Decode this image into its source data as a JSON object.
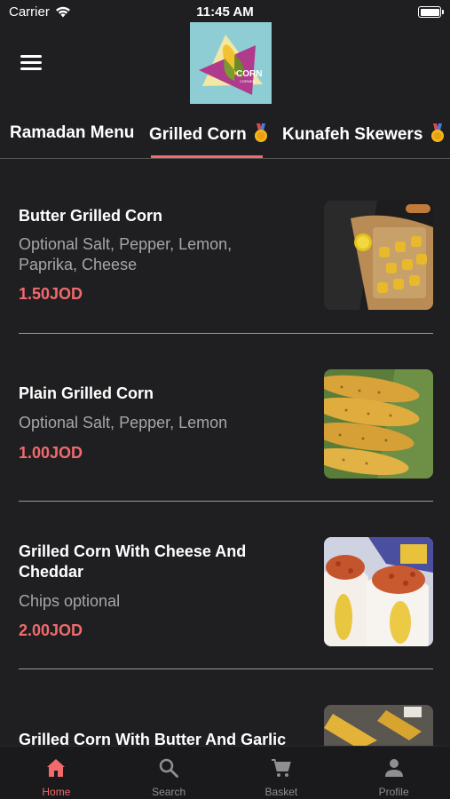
{
  "status_bar": {
    "carrier": "Carrier",
    "time": "11:45 AM"
  },
  "header": {
    "logo_text": "CORN",
    "logo_subtext": "CORNER"
  },
  "categories": [
    {
      "label": "Ramadan Menu"
    },
    {
      "label": "Grilled Corn",
      "selected": true
    },
    {
      "label": "Kunafeh Skewers"
    }
  ],
  "items": [
    {
      "name": "Butter Grilled Corn",
      "description": "Optional Salt, Pepper, Lemon, Paprika, Cheese",
      "price": "1.50JOD"
    },
    {
      "name": "Plain Grilled Corn",
      "description": "Optional Salt, Pepper, Lemon",
      "price": "1.00JOD"
    },
    {
      "name": "Grilled Corn With Cheese And Cheddar",
      "description": "Chips optional",
      "price": "2.00JOD"
    },
    {
      "name": "Grilled Corn With Butter And Garlic",
      "description": "",
      "price": ""
    }
  ],
  "tab_bar": [
    {
      "label": "Home",
      "icon": "home-icon",
      "active": true
    },
    {
      "label": "Search",
      "icon": "search-icon"
    },
    {
      "label": "Basket",
      "icon": "cart-icon"
    },
    {
      "label": "Profile",
      "icon": "profile-icon"
    }
  ],
  "colors": {
    "accent": "#f06a6e",
    "background": "#1f1f21",
    "muted_text": "#a6a6a8"
  }
}
